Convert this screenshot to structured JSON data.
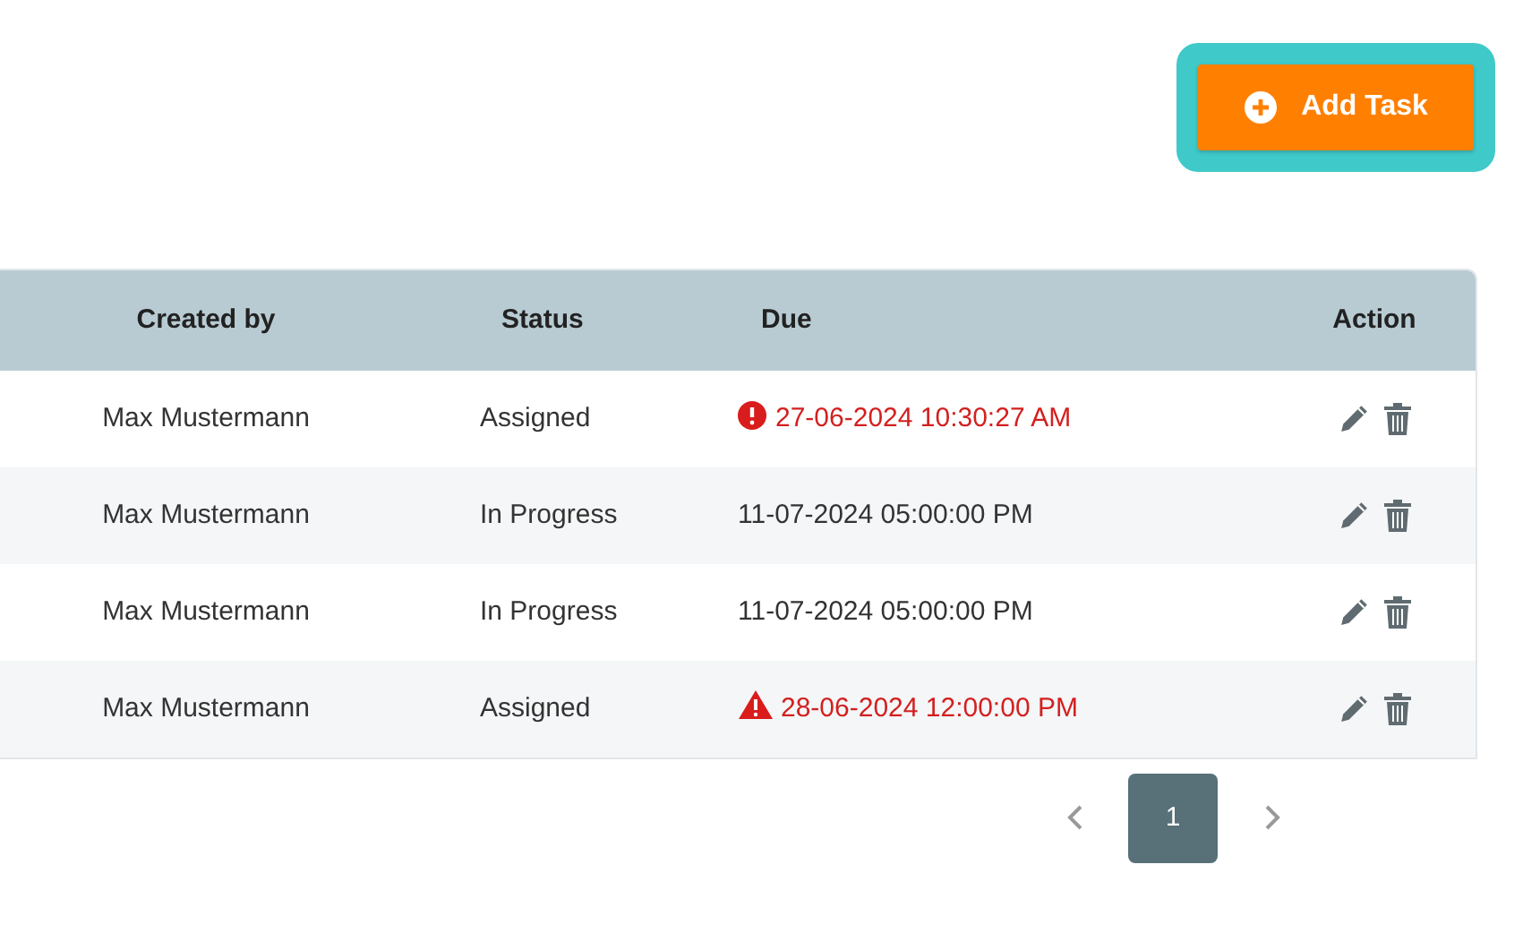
{
  "add_task_button": {
    "label": "Add Task",
    "focused": true
  },
  "table": {
    "columns": [
      "Created by",
      "Status",
      "Due",
      "Action"
    ],
    "rows": [
      {
        "created_by": "Max Mustermann",
        "status": "Assigned",
        "due": "27-06-2024 10:30:27 AM",
        "kind": "overdue"
      },
      {
        "created_by": "Max Mustermann",
        "status": "In Progress",
        "due": "11-07-2024 05:00:00 PM"
      },
      {
        "created_by": "Max Mustermann",
        "status": "In Progress",
        "due": "11-07-2024 05:00:00 PM"
      },
      {
        "created_by": "Max Mustermann",
        "status": "Assigned",
        "due": "28-06-2024 12:00:00 PM",
        "kind": "warning"
      }
    ]
  },
  "pagination": {
    "pages": [
      {
        "label": "1",
        "selected": true
      }
    ]
  }
}
